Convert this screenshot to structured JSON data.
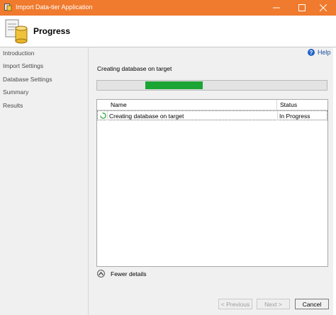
{
  "window": {
    "title": "Import Data-tier Application",
    "titlebar_color": "#f07a2e"
  },
  "header": {
    "page_title": "Progress",
    "icon": "wizard-database-icon"
  },
  "sidebar": {
    "items": [
      {
        "label": "Introduction"
      },
      {
        "label": "Import Settings"
      },
      {
        "label": "Database Settings"
      },
      {
        "label": "Summary"
      },
      {
        "label": "Results"
      }
    ]
  },
  "help": {
    "label": "Help",
    "icon": "help-icon"
  },
  "progress": {
    "status_text": "Creating database on target",
    "indicator": "marquee",
    "segment_start_fraction": 0.21,
    "segment_end_fraction": 0.46,
    "color": "#1ba535"
  },
  "table": {
    "columns": [
      "Name",
      "Status"
    ],
    "rows": [
      {
        "name": "Creating database on target",
        "status": "In Progress",
        "icon": "in-progress-spinner-icon"
      }
    ]
  },
  "details_toggle": {
    "label": "Fewer details",
    "icon": "collapse-up-icon"
  },
  "buttons": {
    "previous": "< Previous",
    "next": "Next >",
    "cancel": "Cancel"
  }
}
